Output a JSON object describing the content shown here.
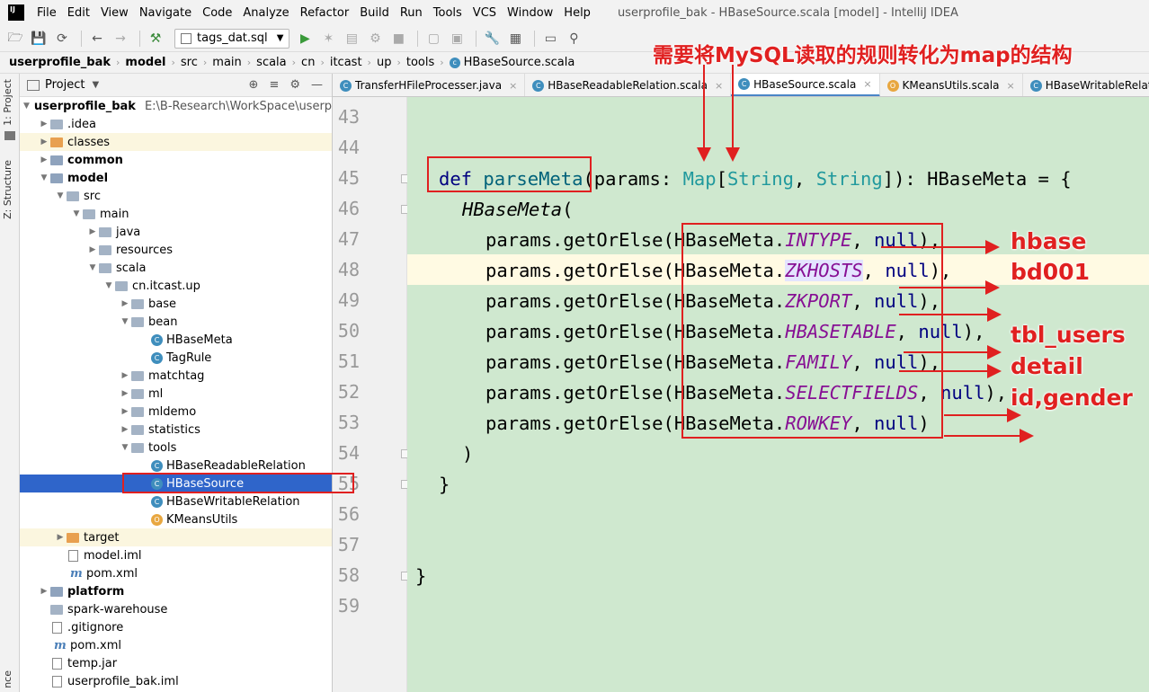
{
  "window": {
    "title": "userprofile_bak - HBaseSource.scala [model] - IntelliJ IDEA"
  },
  "menu": [
    "File",
    "Edit",
    "View",
    "Navigate",
    "Code",
    "Analyze",
    "Refactor",
    "Build",
    "Run",
    "Tools",
    "VCS",
    "Window",
    "Help"
  ],
  "toolbar": {
    "run_config": "tags_dat.sql"
  },
  "breadcrumbs": [
    "userprofile_bak",
    "model",
    "src",
    "main",
    "scala",
    "cn",
    "itcast",
    "up",
    "tools",
    "HBaseSource.scala"
  ],
  "stripe": {
    "project_tab": "1: Project",
    "structure_tab": "Z: Structure",
    "bottom_tab": "nce"
  },
  "project_panel": {
    "title": "Project",
    "tree": [
      {
        "label": "userprofile_bak",
        "path": "E:\\B-Research\\WorkSpace\\userprof",
        "bold": true
      },
      {
        "label": ".idea"
      },
      {
        "label": "classes"
      },
      {
        "label": "common",
        "bold": true
      },
      {
        "label": "model",
        "bold": true
      },
      {
        "label": "src"
      },
      {
        "label": "main"
      },
      {
        "label": "java"
      },
      {
        "label": "resources"
      },
      {
        "label": "scala"
      },
      {
        "label": "cn.itcast.up"
      },
      {
        "label": "base"
      },
      {
        "label": "bean"
      },
      {
        "label": "HBaseMeta"
      },
      {
        "label": "TagRule"
      },
      {
        "label": "matchtag"
      },
      {
        "label": "ml"
      },
      {
        "label": "mldemo"
      },
      {
        "label": "statistics"
      },
      {
        "label": "tools"
      },
      {
        "label": "HBaseReadableRelation"
      },
      {
        "label": "HBaseSource"
      },
      {
        "label": "HBaseWritableRelation"
      },
      {
        "label": "KMeansUtils"
      },
      {
        "label": "target"
      },
      {
        "label": "model.iml"
      },
      {
        "label": "pom.xml"
      },
      {
        "label": "platform",
        "bold": true
      },
      {
        "label": "spark-warehouse"
      },
      {
        "label": ".gitignore"
      },
      {
        "label": "pom.xml"
      },
      {
        "label": "temp.jar"
      },
      {
        "label": "userprofile_bak.iml"
      }
    ]
  },
  "editor_tabs": [
    "TransferHFileProcesser.java",
    "HBaseReadableRelation.scala",
    "HBaseSource.scala",
    "KMeansUtils.scala",
    "HBaseWritableRelation."
  ],
  "line_numbers": [
    "43",
    "44",
    "45",
    "46",
    "47",
    "48",
    "49",
    "50",
    "51",
    "52",
    "53",
    "54",
    "55",
    "56",
    "57",
    "58",
    "59"
  ],
  "code": {
    "kw_def": "def",
    "fn_name": "parseMeta",
    "sig_1": "(params: ",
    "type_map": "Map",
    "br_open": "[",
    "type_string": "String",
    "comma_sp": ", ",
    "sig_2": "]): HBaseMeta = {",
    "ctor": "HBaseMeta",
    "paren_open": "(",
    "call_prefix": "params.getOrElse(HBaseMeta.",
    "nul": "null",
    "close_paren": ")",
    "close_brace": "}",
    "sep": ", ",
    "end_comma": "),",
    "fields": [
      "INTYPE",
      "ZKHOSTS",
      "ZKPORT",
      "HBASETABLE",
      "FAMILY",
      "SELECTFIELDS",
      "ROWKEY"
    ]
  },
  "annotations": {
    "title": "需要将MySQL读取的规则转化为map的结构",
    "values": [
      "hbase",
      "bd001",
      "tbl_users",
      "detail",
      "id,gender"
    ],
    "color": "#e02020"
  }
}
